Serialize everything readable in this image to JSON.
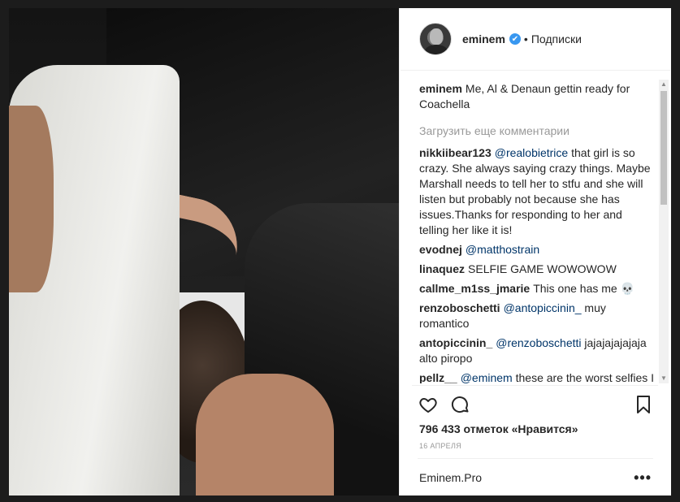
{
  "post": {
    "author": "eminem",
    "verified_mark": "✔",
    "separator": "•",
    "follow_status": "Подписки",
    "caption": {
      "user": "eminem",
      "text": "Me, Al & Denaun gettin ready for Coachella"
    },
    "load_more": "Загрузить еще комментарии",
    "comments": [
      {
        "user": "nikkiibear123",
        "mention": "@realobietrice",
        "text": " that girl is so crazy. She always saying crazy things. Maybe Marshall needs to tell her to stfu and she will listen but probably not because she has issues.Thanks for responding to her and telling her like it is!"
      },
      {
        "user": "evodnej",
        "mention": "@matthostrain",
        "text": ""
      },
      {
        "user": "linaquez",
        "mention": "",
        "text": "SELFIE GAME WOWOWOW"
      },
      {
        "user": "callme_m1ss_jmarie",
        "mention": "",
        "text": "This one has me 💀"
      },
      {
        "user": "renzoboschetti",
        "mention": "@antopiccinin_",
        "text": " muy romantico"
      },
      {
        "user": "antopiccinin_",
        "mention": "@renzoboschetti",
        "text": " jajajajajajaja alto piropo"
      },
      {
        "user": "pellz__",
        "mention": "@eminem",
        "text": " these are the worst selfies I ever seen"
      }
    ],
    "likes": "796 433 отметок «Нравится»",
    "date": "16 АПРЕЛЯ",
    "footer_name": "Eminem.Pro",
    "more": "•••"
  },
  "icons": {
    "like": "heart-icon",
    "comment": "comment-icon",
    "save": "bookmark-icon"
  },
  "colors": {
    "mention": "#003569",
    "verified": "#3897f0",
    "muted": "#999999"
  }
}
